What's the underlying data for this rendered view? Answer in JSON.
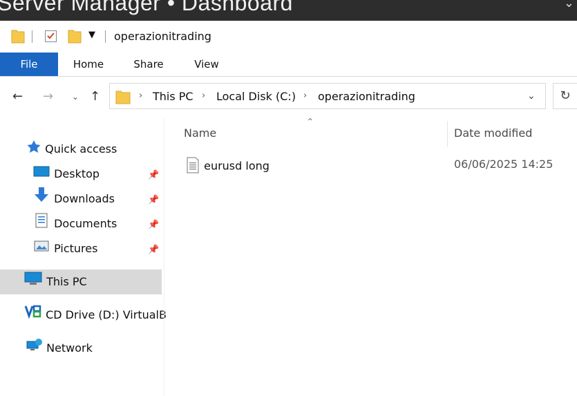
{
  "window": {
    "title": "Server Manager • Dashboard"
  },
  "quick_access_toolbar": {
    "folder_title": "operazionitrading"
  },
  "ribbon": {
    "tabs": [
      "File",
      "Home",
      "Share",
      "View"
    ]
  },
  "address_bar": {
    "crumbs": [
      "This PC",
      "Local Disk (C:)",
      "operazionitrading"
    ],
    "separator": "›"
  },
  "navigation": {
    "quick_access": "Quick access",
    "pinned": [
      {
        "label": "Desktop",
        "icon": "desktop-icon"
      },
      {
        "label": "Downloads",
        "icon": "download-arrow-icon"
      },
      {
        "label": "Documents",
        "icon": "documents-icon"
      },
      {
        "label": "Pictures",
        "icon": "pictures-icon"
      }
    ],
    "this_pc": "This PC",
    "cd_drive": "CD Drive (D:) VirtualB",
    "network": "Network"
  },
  "file_list": {
    "columns": [
      "Name",
      "Date modified"
    ],
    "rows": [
      {
        "name": "eurusd long",
        "date_modified": "06/06/2025 14:25",
        "icon": "text-file-icon"
      }
    ]
  },
  "colors": {
    "file_tab": "#1a66c2",
    "selected_nav": "#d9d9d9",
    "folder": "#f5c84c"
  }
}
